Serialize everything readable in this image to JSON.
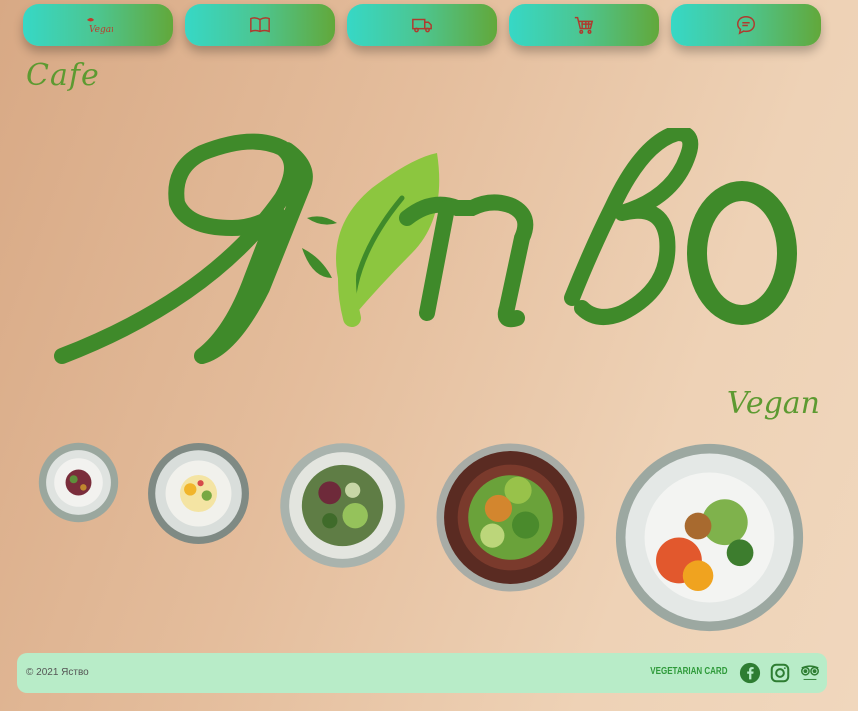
{
  "nav": {
    "items": [
      {
        "icon": "vegan-home-icon",
        "logo_text": "Vegan"
      },
      {
        "icon": "book-open-icon"
      },
      {
        "icon": "delivery-truck-icon"
      },
      {
        "icon": "shopping-cart-icon"
      },
      {
        "icon": "chat-bubble-icon"
      }
    ]
  },
  "hero": {
    "cafe_label": "Cafe",
    "logo_text": "Ястьо",
    "vegan_label": "Vegan"
  },
  "dishes": [
    {
      "name": "dish-1"
    },
    {
      "name": "dish-2"
    },
    {
      "name": "dish-3"
    },
    {
      "name": "dish-4"
    },
    {
      "name": "dish-5"
    }
  ],
  "footer": {
    "copyright": "© 2021 Яство",
    "vegetarian_card_label": "VEGETARIAN CARD",
    "social": [
      "facebook-icon",
      "instagram-icon",
      "tripadvisor-icon"
    ]
  },
  "colors": {
    "brand_green": "#3f8a2a",
    "leaf_green": "#8cc63f",
    "accent_teal": "#36d8c6",
    "footer_bg": "#b8ecc8"
  }
}
